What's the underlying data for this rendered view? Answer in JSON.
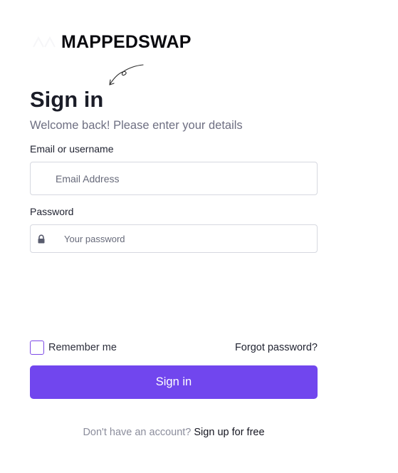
{
  "brand": {
    "name": "MAPPEDSWAP",
    "logo_icon": "brand-mark-icon",
    "doodle_icon": "curly-arrow-icon"
  },
  "form": {
    "title": "Sign in",
    "subtitle": "Welcome back! Please enter your details",
    "email_label": "Email or username",
    "email_placeholder": "Email Address",
    "email_value": "",
    "password_label": "Password",
    "password_placeholder": "Your password",
    "password_value": "",
    "password_icon": "lock-icon",
    "remember_label": "Remember me",
    "remember_checked": false,
    "forgot_label": "Forgot password?",
    "submit_label": "Sign in"
  },
  "footer": {
    "prompt": "Don't have an account?",
    "signup_label": "Sign up for free"
  },
  "colors": {
    "accent": "#7146ee",
    "checkbox_border": "#7d4ae6",
    "text_muted": "#6e6f82"
  }
}
